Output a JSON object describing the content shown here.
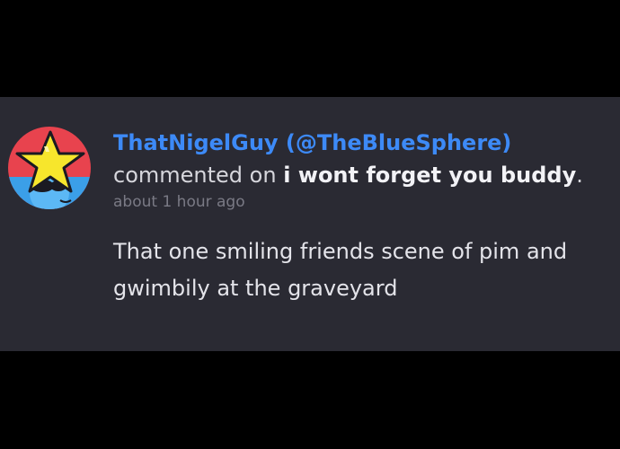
{
  "comment": {
    "author": "ThatNigelGuy (@TheBlueSphere)",
    "action": "commented on",
    "post_title": "i wont forget you buddy",
    "title_suffix": ".",
    "timestamp": "about 1 hour ago",
    "body": "That one smiling friends scene of pim and gwimbily at the graveyard"
  },
  "colors": {
    "background": "#000000",
    "card": "#2a2a33",
    "username": "#3d8af7",
    "text": "#e4e4ea",
    "muted": "#7a7a85"
  },
  "icons": {
    "avatar": "star-and-blue-sphere-avatar-icon"
  }
}
